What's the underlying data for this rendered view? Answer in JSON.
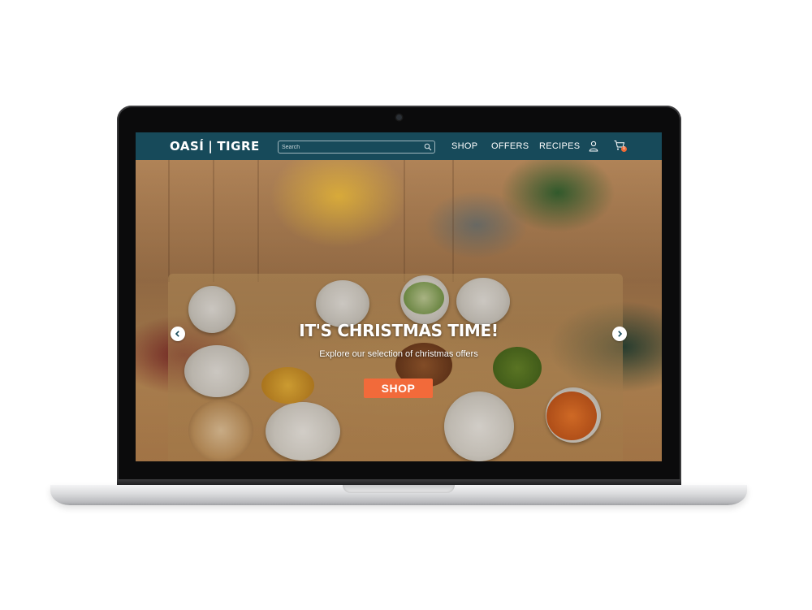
{
  "header": {
    "logo_left": "OASÍ",
    "logo_separator": "|",
    "logo_right": "TIGRE",
    "search_placeholder": "Search",
    "nav": [
      {
        "label": "SHOP"
      },
      {
        "label": "OFFERS"
      },
      {
        "label": "RECIPES"
      }
    ],
    "cart_count": "0"
  },
  "hero": {
    "title": "IT'S  CHRISTMAS TIME!",
    "subtitle": "Explore our selection of christmas offers",
    "cta_label": "SHOP"
  },
  "icons": {
    "search": "search-icon",
    "user": "user-icon",
    "cart": "cart-icon",
    "prev": "chevron-left-icon",
    "next": "chevron-right-icon"
  },
  "colors": {
    "header_bg": "#174a5a",
    "accent": "#f26a3a",
    "text_light": "#ffffff"
  }
}
